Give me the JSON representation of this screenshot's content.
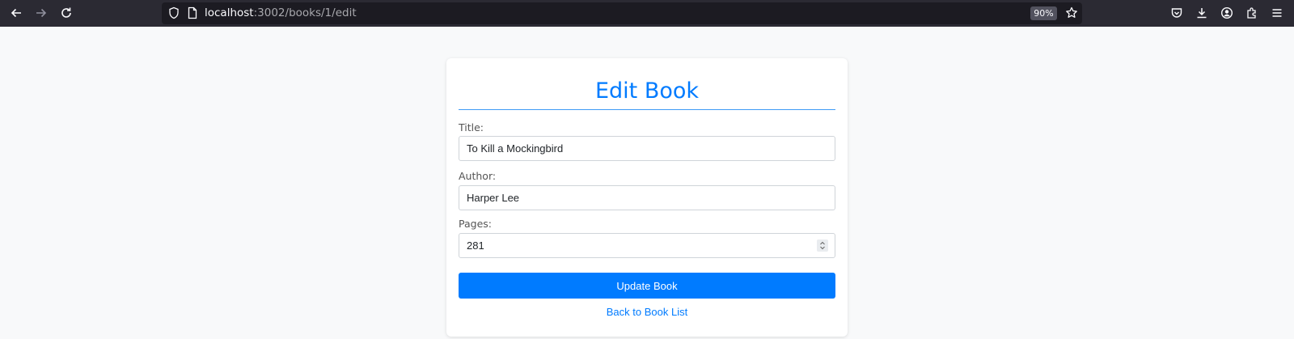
{
  "browser": {
    "url_host": "localhost",
    "url_path": ":3002/books/1/edit",
    "zoom": "90%"
  },
  "form": {
    "heading": "Edit Book",
    "title_label": "Title:",
    "title_value": "To Kill a Mockingbird",
    "author_label": "Author:",
    "author_value": "Harper Lee",
    "pages_label": "Pages:",
    "pages_value": "281",
    "submit_label": "Update Book",
    "back_link": "Back to Book List"
  },
  "colors": {
    "accent": "#007bff",
    "page_background": "#f8f9fa",
    "toolbar": "#2b2a33"
  }
}
